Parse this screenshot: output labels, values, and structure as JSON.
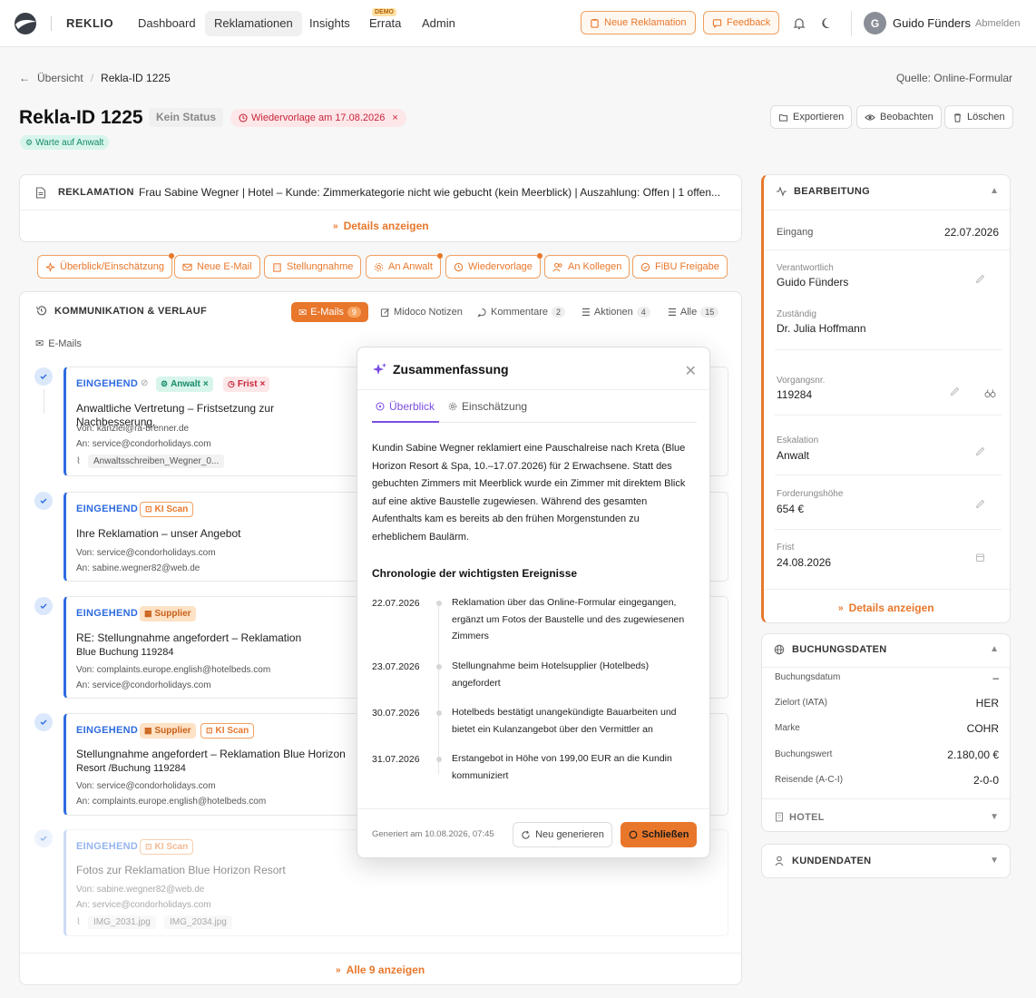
{
  "nav": {
    "brand": "REKLIO",
    "links": [
      "Dashboard",
      "Reklamationen",
      "Insights",
      "Errata",
      "Admin"
    ],
    "demo_badge": "DEMO",
    "new_button": "Neue Reklamation",
    "feedback_button": "Feedback",
    "avatar_initial": "G",
    "user_name": "Guido Fünders",
    "logout": "Abmelden"
  },
  "breadcrumb": {
    "back": "Übersicht",
    "current": "Rekla-ID 1225"
  },
  "source": "Quelle: Online-Formular",
  "header": {
    "title": "Rekla-ID 1225",
    "status": "Kein Status",
    "wiedervorlage": "Wiedervorlage am 17.08.2026",
    "tag": "Warte auf Anwalt",
    "buttons": [
      "Exportieren",
      "Beobachten",
      "Löschen"
    ]
  },
  "reklamation": {
    "label": "REKLAMATION",
    "text": "Frau Sabine Wegner | Hotel – Kunde: Zimmerkategorie nicht wie gebucht (kein Meerblick) | Auszahlung: Offen | 1 offen...",
    "details": "Details anzeigen"
  },
  "actions": [
    "Überblick/Einschätzung",
    "Neue E-Mail",
    "Stellungnahme",
    "An Anwalt",
    "Wiedervorlage",
    "An Kollegen",
    "FiBU Freigabe"
  ],
  "kommunikation": {
    "title": "KOMMUNIKATION & VERLAUF",
    "tabs": [
      {
        "label": "E-Mails",
        "count": "9"
      },
      {
        "label": "Midoco Notizen",
        "count": ""
      },
      {
        "label": "Kommentare",
        "count": "2"
      },
      {
        "label": "Aktionen",
        "count": "4"
      },
      {
        "label": "Alle",
        "count": "15"
      }
    ],
    "emails_label": "E-Mails",
    "show_all": "Alle 9 anzeigen",
    "emails": [
      {
        "dir": "EINGEHEND",
        "tags": [
          "Anwalt",
          "Frist"
        ],
        "subject": "Anwaltliche Vertretung – Fristsetzung zur Nachbesserung,",
        "from": "Von: kanzlei@ra-brenner.de",
        "to": "An: service@condorholidays.com",
        "attachments": [
          "Anwaltsschreiben_Wegner_0..."
        ]
      },
      {
        "dir": "EINGEHEND",
        "tags": [
          "KI Scan"
        ],
        "subject": "Ihre Reklamation – unser Angebot",
        "from": "Von: service@condorholidays.com",
        "to": "An: sabine.wegner82@web.de"
      },
      {
        "dir": "EINGEHEND",
        "tags": [
          "Supplier"
        ],
        "subject": "RE: Stellungnahme angefordert – Reklamation",
        "subject2": "Blue Buchung 119284",
        "from": "Von: complaints.europe.english@hotelbeds.com",
        "to": "An: service@condorholidays.com"
      },
      {
        "dir": "EINGEHEND",
        "tags": [
          "Supplier",
          "KI Scan"
        ],
        "subject": "Stellungnahme angefordert – Reklamation Blue Horizon",
        "subject2": "Resort /Buchung 119284",
        "from": "Von: service@condorholidays.com",
        "to": "An: complaints.europe.english@hotelbeds.com"
      },
      {
        "dir": "EINGEHEND",
        "tags": [
          "KI Scan"
        ],
        "subject": "Fotos zur Reklamation Blue Horizon Resort",
        "from": "Von: sabine.wegner82@web.de",
        "to": "An: service@condorholidays.com",
        "attachments": [
          "IMG_2031.jpg",
          "IMG_2034.jpg"
        ]
      }
    ]
  },
  "modal": {
    "title": "Zusammenfassung",
    "tabs": [
      "Überblick",
      "Einschätzung"
    ],
    "body": "Kundin Sabine Wegner reklamiert eine Pauschalreise nach Kreta (Blue Horizon Resort & Spa, 10.–17.07.2026) für 2 Erwachsene. Statt des gebuchten Zimmers mit Meerblick wurde ein Zimmer mit direktem Blick auf eine aktive Baustelle zugewiesen. Während des gesamten Aufenthalts kam es bereits ab den frühen Morgenstunden zu erheblichem Baulärm.",
    "chrono_title": "Chronologie der wichtigsten Ereignisse",
    "chronology": [
      {
        "date": "22.07.2026",
        "text": "Reklamation über das Online-Formular eingegangen, ergänzt um Fotos der Baustelle und des zugewiesenen Zimmers"
      },
      {
        "date": "23.07.2026",
        "text": "Stellungnahme beim Hotelsupplier (Hotelbeds) angefordert"
      },
      {
        "date": "30.07.2026",
        "text": "Hotelbeds bestätigt unangekündigte Bauarbeiten und bietet ein Kulanzangebot über den Vermittler an"
      },
      {
        "date": "31.07.2026",
        "text": "Erstangebot in Höhe von 199,00 EUR an die Kundin kommuniziert"
      }
    ],
    "generated": "Generiert am 10.08.2026, 07:45",
    "regenerate": "Neu generieren",
    "close": "Schließen"
  },
  "bearbeitung": {
    "title": "BEARBEITUNG",
    "eingang_label": "Eingang",
    "eingang_value": "22.07.2026",
    "fields": [
      {
        "label": "Verantwortlich",
        "value": "Guido Fünders"
      },
      {
        "label": "Zuständig",
        "value": "Dr. Julia Hoffmann"
      },
      {
        "label": "Vorgangsnr.",
        "value": "119284"
      },
      {
        "label": "Eskalation",
        "value": "Anwalt"
      },
      {
        "label": "Forderungshöhe",
        "value": "654 €"
      },
      {
        "label": "Frist",
        "value": "24.08.2026"
      }
    ],
    "details": "Details anzeigen"
  },
  "buchungsdaten": {
    "title": "BUCHUNGSDATEN",
    "rows": [
      {
        "label": "Buchungsdatum",
        "value": "–"
      },
      {
        "label": "Zielort (IATA)",
        "value": "HER"
      },
      {
        "label": "Marke",
        "value": "COHR"
      },
      {
        "label": "Buchungswert",
        "value": "2.180,00 €"
      },
      {
        "label": "Reisende (A-C-I)",
        "value": "2-0-0"
      }
    ],
    "hotel": "HOTEL"
  },
  "kundendaten": {
    "title": "KUNDENDATEN"
  },
  "colors": {
    "accent": "#e8772b",
    "blue": "#2d6be0",
    "purple": "#7b4de0",
    "danger": "#c8253a",
    "success": "#168a68"
  }
}
